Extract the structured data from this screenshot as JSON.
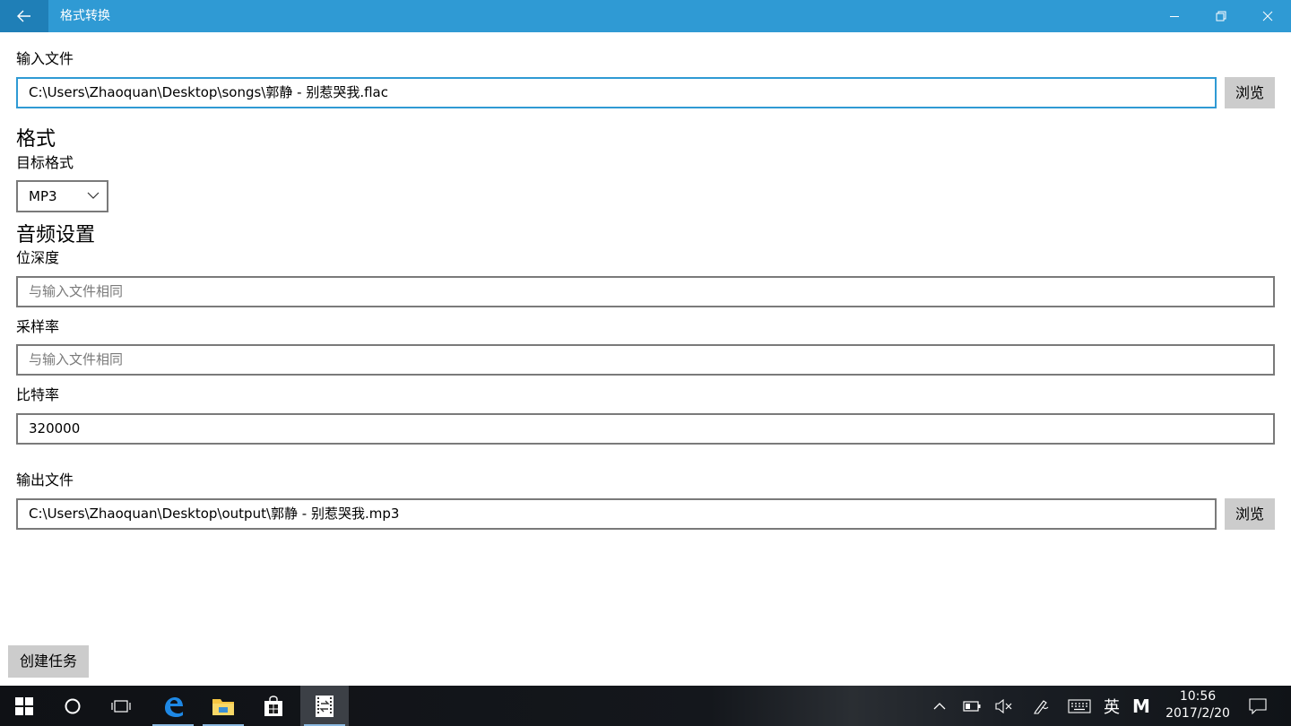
{
  "window": {
    "title": "格式转换"
  },
  "input_file": {
    "label": "输入文件",
    "value": "C:\\Users\\Zhaoquan\\Desktop\\songs\\郭静 - 别惹哭我.flac",
    "browse_label": "浏览"
  },
  "format": {
    "heading": "格式",
    "target_label": "目标格式",
    "selected": "MP3"
  },
  "audio": {
    "heading": "音频设置",
    "bit_depth_label": "位深度",
    "bit_depth_placeholder": "与输入文件相同",
    "sample_rate_label": "采样率",
    "sample_rate_placeholder": "与输入文件相同",
    "bitrate_label": "比特率",
    "bitrate_value": "320000"
  },
  "output_file": {
    "label": "输出文件",
    "value": "C:\\Users\\Zhaoquan\\Desktop\\output\\郭静 - 别惹哭我.mp3",
    "browse_label": "浏览"
  },
  "actions": {
    "create_task_label": "创建任务"
  },
  "taskbar": {
    "ime_label": "英",
    "ime_mode": "M",
    "time": "10:56",
    "date": "2017/2/20"
  },
  "colors": {
    "accent": "#2f9ad4",
    "back_button": "#1f7fb7",
    "button_gray": "#cccccc"
  }
}
